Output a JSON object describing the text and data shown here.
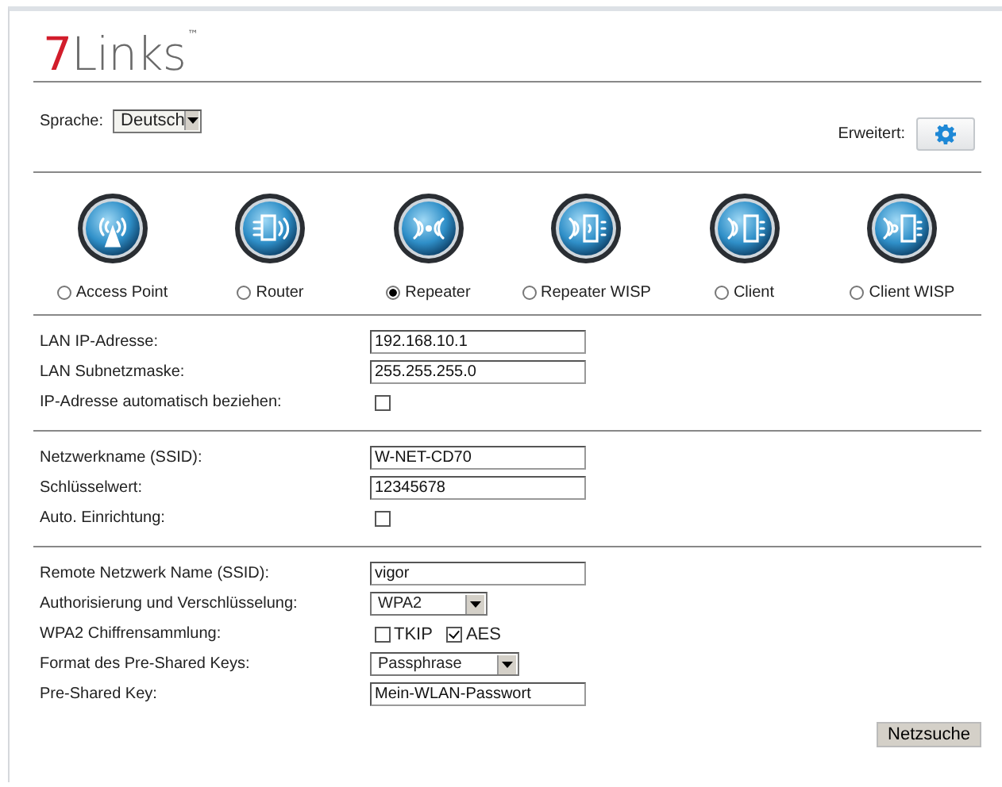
{
  "logo": {
    "mark": "7",
    "name": "Links",
    "tm": "™"
  },
  "language": {
    "label": "Sprache:",
    "value": "Deutsch"
  },
  "advanced": {
    "label": "Erweitert:"
  },
  "modes": [
    {
      "kind": "access_point",
      "label": "Access Point",
      "selected": false
    },
    {
      "kind": "router",
      "label": "Router",
      "selected": false
    },
    {
      "kind": "repeater",
      "label": "Repeater",
      "selected": true
    },
    {
      "kind": "repeater_wisp",
      "label": "Repeater WISP",
      "selected": false
    },
    {
      "kind": "client",
      "label": "Client",
      "selected": false
    },
    {
      "kind": "client_wisp",
      "label": "Client WISP",
      "selected": false
    }
  ],
  "sections": [
    {
      "rows": [
        {
          "kind": "text",
          "label": "LAN IP-Adresse:",
          "value": "192.168.10.1"
        },
        {
          "kind": "text",
          "label": "LAN Subnetzmaske:",
          "value": "255.255.255.0"
        },
        {
          "kind": "checkbox",
          "label": "IP-Adresse automatisch beziehen:",
          "checked": false
        }
      ]
    },
    {
      "rows": [
        {
          "kind": "text",
          "label": "Netzwerkname (SSID):",
          "value": "W-NET-CD70"
        },
        {
          "kind": "text",
          "label": "Schlüsselwert:",
          "value": "12345678"
        },
        {
          "kind": "checkbox",
          "label": "Auto. Einrichtung:",
          "checked": false
        }
      ]
    },
    {
      "rows": [
        {
          "kind": "text",
          "label": "Remote Netzwerk Name (SSID):",
          "value": "vigor"
        },
        {
          "kind": "select",
          "label": "Authorisierung und Verschlüsselung:",
          "value": "WPA2"
        },
        {
          "kind": "checkgroup",
          "label": "WPA2 Chiffrensammlung:",
          "options": [
            {
              "label": "TKIP",
              "checked": false
            },
            {
              "label": "AES",
              "checked": true
            }
          ]
        },
        {
          "kind": "select",
          "label": "Format des Pre-Shared Keys:",
          "value": "Passphrase"
        },
        {
          "kind": "text",
          "label": "Pre-Shared Key:",
          "value": "Mein-WLAN-Passwort"
        }
      ]
    }
  ],
  "search_button": "Netzsuche"
}
